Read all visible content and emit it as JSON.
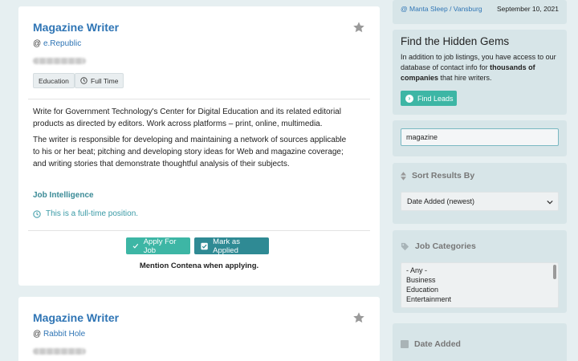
{
  "jobs": [
    {
      "title": "Magazine Writer",
      "at": "@",
      "company": "e.Republic",
      "tags": [
        "Education",
        "Full Time"
      ],
      "description": [
        "Write for Government Technology's Center for Digital Education and its related editorial products as directed by editors. Work across platforms – print, online, multimedia.",
        "The writer is responsible for developing and maintaining a network of sources applicable to his or her beat; pitching and developing story ideas for Web and magazine coverage; and writing stories that demonstrate thoughtful analysis of their subjects."
      ],
      "intel_label": "Job Intelligence",
      "intel_text": "This is a full-time position.",
      "apply_label": "Apply For Job",
      "mark_label": "Mark as Applied",
      "mention": "Mention Contena when applying."
    },
    {
      "title": "Magazine Writer",
      "at": "@",
      "company": "Rabbit Hole"
    }
  ],
  "sidebar": {
    "top_link": "@ Manta Sleep / Vansburg",
    "top_date": "September 10, 2021",
    "gems": {
      "title": "Find the Hidden Gems",
      "text_before": "In addition to job listings, you have access to our database of contact info for ",
      "text_bold": "thousands of companies",
      "text_after": " that hire writers.",
      "button": "Find Leads"
    },
    "search_value": "magazine",
    "sort": {
      "heading": "Sort Results By",
      "selected": "Date Added (newest)"
    },
    "categories": {
      "heading": "Job Categories",
      "options": [
        "- Any -",
        "Business",
        "Education",
        "Entertainment"
      ]
    },
    "date": {
      "heading": "Date Added"
    }
  },
  "colors": {
    "accent": "#3db6a5",
    "link": "#2f75b5",
    "dark_teal": "#2f8a94"
  }
}
